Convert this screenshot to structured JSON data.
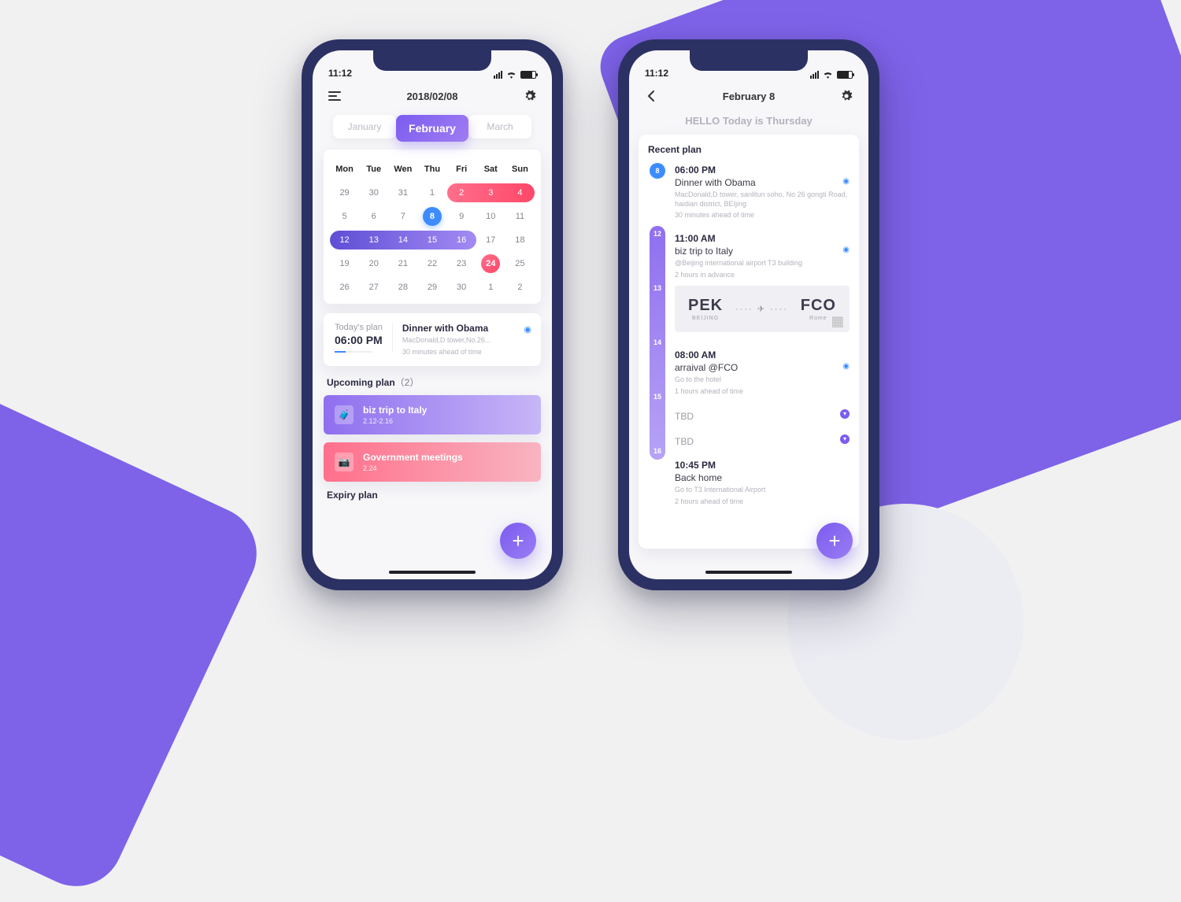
{
  "status": {
    "time": "11:12"
  },
  "screen1": {
    "date_title": "2018/02/08",
    "months": {
      "prev": "January",
      "current": "February",
      "next": "March"
    },
    "weekdays": [
      "Mon",
      "Tue",
      "Wen",
      "Thu",
      "Fri",
      "Sat",
      "Sun"
    ],
    "grid": [
      [
        {
          "d": 29,
          "dim": true
        },
        {
          "d": 30,
          "dim": true
        },
        {
          "d": 31,
          "dim": true
        },
        {
          "d": 1
        },
        {
          "d": 2,
          "range": "pink"
        },
        {
          "d": 3,
          "range": "pink"
        },
        {
          "d": 4,
          "range": "pink"
        }
      ],
      [
        {
          "d": 5
        },
        {
          "d": 6
        },
        {
          "d": 7
        },
        {
          "d": 8,
          "today": true
        },
        {
          "d": 9
        },
        {
          "d": 10
        },
        {
          "d": 11
        }
      ],
      [
        {
          "d": 12,
          "range": "purple"
        },
        {
          "d": 13,
          "range": "purple"
        },
        {
          "d": 14,
          "range": "purple"
        },
        {
          "d": 15,
          "range": "purple"
        },
        {
          "d": 16,
          "range": "purple"
        },
        {
          "d": 17
        },
        {
          "d": 18
        }
      ],
      [
        {
          "d": 19
        },
        {
          "d": 20
        },
        {
          "d": 21
        },
        {
          "d": 22
        },
        {
          "d": 23
        },
        {
          "d": 24,
          "red": true
        },
        {
          "d": 25
        }
      ],
      [
        {
          "d": 26
        },
        {
          "d": 27
        },
        {
          "d": 28
        },
        {
          "d": 29,
          "dim": true
        },
        {
          "d": 30,
          "dim": true
        },
        {
          "d": 1,
          "dim": true
        },
        {
          "d": 2,
          "dim": true
        }
      ]
    ],
    "today_plan": {
      "label": "Today's plan",
      "time": "06:00 PM",
      "title": "Dinner with Obama",
      "location": "MacDonald,D tower,No.26...",
      "note": "30 minutes ahead of time"
    },
    "upcoming_label": "Upcoming plan",
    "upcoming_count": "（2）",
    "upcoming": [
      {
        "title": "biz trip to Italy",
        "date": "2.12-2.16",
        "color": "purple",
        "icon": "briefcase"
      },
      {
        "title": "Government meetings",
        "date": "2.24",
        "color": "pink",
        "icon": "camera"
      }
    ],
    "expiry_label": "Expiry plan"
  },
  "screen2": {
    "title": "February 8",
    "greeting": "HELLO Today is Thursday",
    "recent_label": "Recent plan",
    "day0": {
      "badge": "8",
      "time": "06:00 PM",
      "title": "Dinner with Obama",
      "sub1": "MacDonald,D tower, sanlitun soho, No 26 gongti Road, haidian district, BEIjing",
      "sub2": "30 minutes ahead of time"
    },
    "bar_days": [
      "12",
      "13",
      "14",
      "15",
      "16"
    ],
    "items": [
      {
        "time": "11:00 AM",
        "title": "biz trip to Italy",
        "sub1": "@Beijing international airport T3 building",
        "sub2": "2 hours in advance",
        "loc": true,
        "flight": {
          "from_code": "PEK",
          "from_city": "BEIJING",
          "to_code": "FCO",
          "to_city": "Rome"
        }
      },
      {
        "time": "08:00 AM",
        "title": "arraival @FCO",
        "sub1": "Go to the hotel",
        "sub2": "1 hours ahead of time",
        "loc": true
      },
      {
        "tbd": true,
        "title": "TBD"
      },
      {
        "tbd": true,
        "title": "TBD"
      },
      {
        "time": "10:45 PM",
        "title": "Back home",
        "sub1": "Go to T3 International Airport",
        "sub2": "2 hours ahead of time"
      }
    ]
  }
}
